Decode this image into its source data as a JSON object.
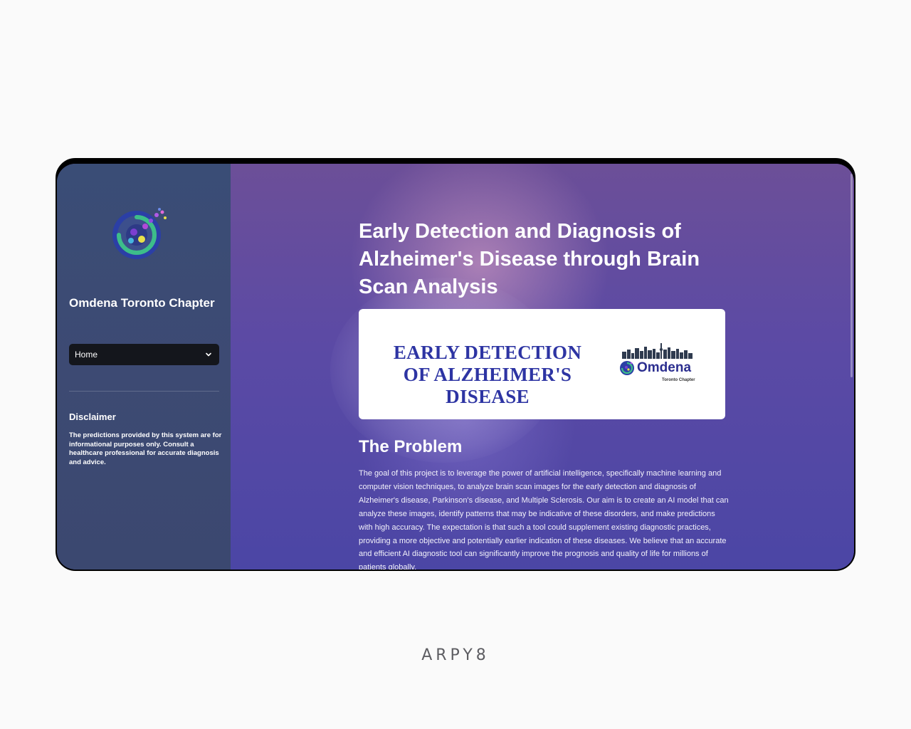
{
  "sidebar": {
    "org_name": "Omdena Toronto Chapter",
    "page_select": {
      "selected": "Home",
      "icon": "chevron-down-icon"
    },
    "disclaimer": {
      "title": "Disclaimer",
      "text": "The predictions provided by this system are for informational purposes only. Consult a healthcare professional for accurate diagnosis and advice."
    },
    "logo_icon": "omdena-logo-icon"
  },
  "main": {
    "title": "Early Detection and Diagnosis of Alzheimer's Disease through Brain Scan Analysis",
    "banner": {
      "text": "EARLY DETECTION OF ALZHEIMER'S DISEASE",
      "brand_name": "Omdena",
      "brand_sub": "Toronto Chapter"
    },
    "problem": {
      "heading": "The Problem",
      "body": "The goal of this project is to leverage the power of artificial intelligence, specifically machine learning and computer vision techniques, to analyze brain scan images for the early detection and diagnosis of Alzheimer's disease, Parkinson's disease, and Multiple Sclerosis. Our aim is to create an AI model that can analyze these images, identify patterns that may be indicative of these disorders, and make predictions with high accuracy. The expectation is that such a tool could supplement existing diagnostic practices, providing a more objective and potentially earlier indication of these diseases. We believe that an accurate and efficient AI diagnostic tool can significantly improve the prognosis and quality of life for millions of patients globally."
    }
  },
  "footer": {
    "brand": "ARPY8"
  },
  "colors": {
    "sidebar_bg": "#3b4a72",
    "main_bg": "#5a4aa5",
    "banner_text": "#2d34a3",
    "select_bg": "#14161c"
  }
}
